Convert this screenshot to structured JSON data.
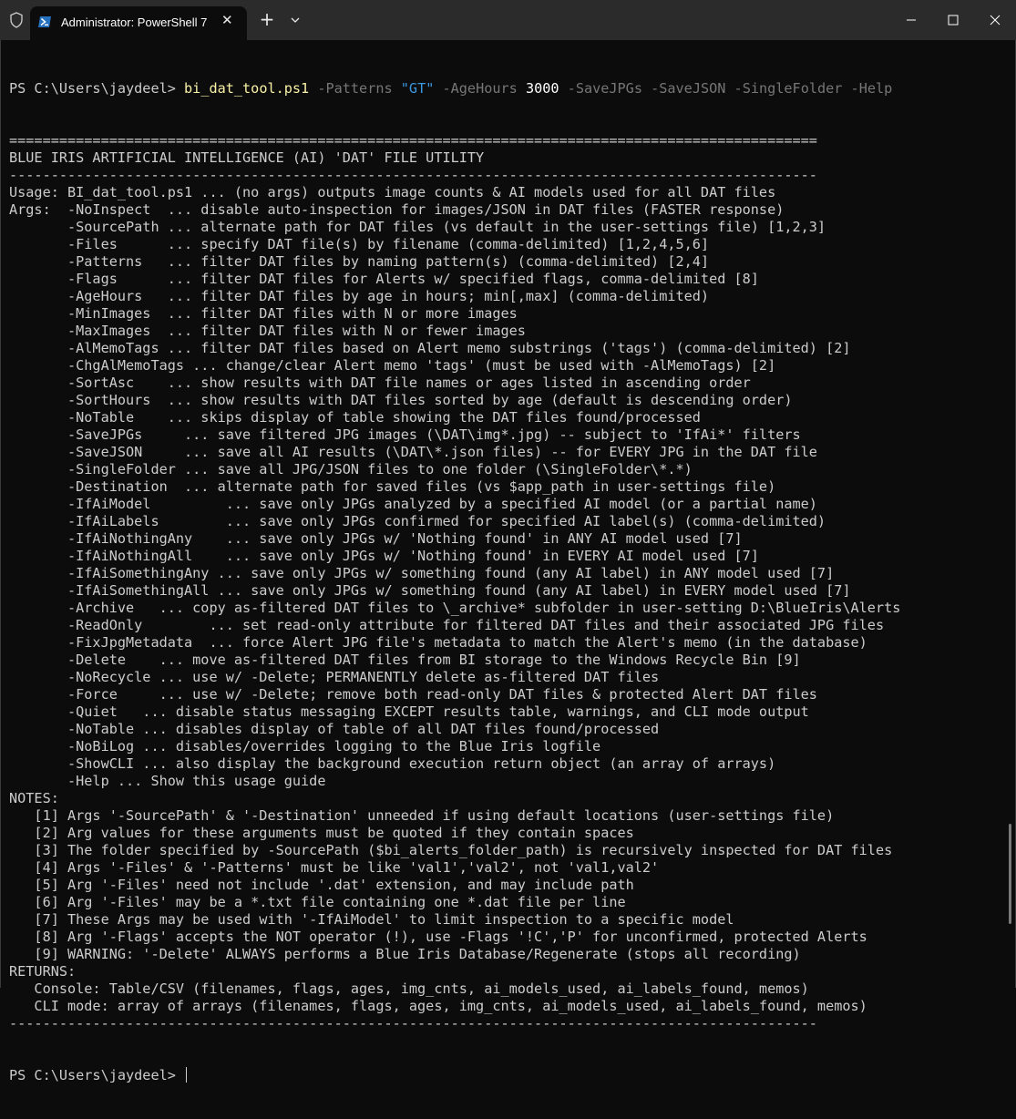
{
  "window": {
    "tab_title": "Administrator: PowerShell 7",
    "new_tab_symbol": "+",
    "tab_close_symbol": "✕",
    "icons": [
      "shield-icon",
      "powershell-icon",
      "close-icon",
      "plus-icon",
      "chevron-down-icon",
      "minimize-icon",
      "maximize-icon",
      "close-window-icon"
    ]
  },
  "colors": {
    "background": "#0c0c0c",
    "foreground": "#cccccc",
    "command": "#f9f1a5",
    "parameter": "#767676",
    "string": "#3a96dd",
    "number": "#ffffff",
    "titlebar": "#2b2b2b"
  },
  "command": {
    "prompt": "PS C:\\Users\\jaydeel> ",
    "script": "bi_dat_tool.ps1",
    "p_patterns": " -Patterns ",
    "v_patterns": "\"GT\"",
    "p_agehours": " -AgeHours ",
    "v_agehours": "3000",
    "p_rest": " -SaveJPGs -SaveJSON -SingleFolder -Help"
  },
  "output": [
    "=================================================================================================",
    "BLUE IRIS ARTIFICIAL INTELLIGENCE (AI) 'DAT' FILE UTILITY",
    "-------------------------------------------------------------------------------------------------",
    "Usage: BI_dat_tool.ps1 ... (no args) outputs image counts & AI models used for all DAT files",
    "Args:  -NoInspect  ... disable auto-inspection for images/JSON in DAT files (FASTER response)",
    "       -SourcePath ... alternate path for DAT files (vs default in the user-settings file) [1,2,3]",
    "       -Files      ... specify DAT file(s) by filename (comma-delimited) [1,2,4,5,6]",
    "       -Patterns   ... filter DAT files by naming pattern(s) (comma-delimited) [2,4]",
    "       -Flags      ... filter DAT files for Alerts w/ specified flags, comma-delimited [8]",
    "       -AgeHours   ... filter DAT files by age in hours; min[,max] (comma-delimited)",
    "       -MinImages  ... filter DAT files with N or more images",
    "       -MaxImages  ... filter DAT files with N or fewer images",
    "       -AlMemoTags ... filter DAT files based on Alert memo substrings ('tags') (comma-delimited) [2]",
    "       -ChgAlMemoTags ... change/clear Alert memo 'tags' (must be used with -AlMemoTags) [2]",
    "       -SortAsc    ... show results with DAT file names or ages listed in ascending order",
    "       -SortHours  ... show results with DAT files sorted by age (default is descending order)",
    "       -NoTable    ... skips display of table showing the DAT files found/processed",
    "       -SaveJPGs     ... save filtered JPG images (\\DAT\\img*.jpg) -- subject to 'IfAi*' filters",
    "       -SaveJSON     ... save all AI results (\\DAT\\*.json files) -- for EVERY JPG in the DAT file",
    "       -SingleFolder ... save all JPG/JSON files to one folder (\\SingleFolder\\*.*)",
    "       -Destination  ... alternate path for saved files (vs $app_path in user-settings file)",
    "       -IfAiModel         ... save only JPGs analyzed by a specified AI model (or a partial name)",
    "       -IfAiLabels        ... save only JPGs confirmed for specified AI label(s) (comma-delimited)",
    "       -IfAiNothingAny    ... save only JPGs w/ 'Nothing found' in ANY AI model used [7]",
    "       -IfAiNothingAll    ... save only JPGs w/ 'Nothing found' in EVERY AI model used [7]",
    "       -IfAiSomethingAny ... save only JPGs w/ something found (any AI label) in ANY model used [7]",
    "       -IfAiSomethingAll ... save only JPGs w/ something found (any AI label) in EVERY model used [7]",
    "       -Archive   ... copy as-filtered DAT files to \\_archive* subfolder in user-setting D:\\BlueIris\\Alerts",
    "       -ReadOnly        ... set read-only attribute for filtered DAT files and their associated JPG files",
    "       -FixJpgMetadata  ... force Alert JPG file's metadata to match the Alert's memo (in the database)",
    "       -Delete    ... move as-filtered DAT files from BI storage to the Windows Recycle Bin [9]",
    "       -NoRecycle ... use w/ -Delete; PERMANENTLY delete as-filtered DAT files",
    "       -Force     ... use w/ -Delete; remove both read-only DAT files & protected Alert DAT files",
    "       -Quiet   ... disable status messaging EXCEPT results table, warnings, and CLI mode output",
    "       -NoTable ... disables display of table of all DAT files found/processed",
    "       -NoBiLog ... disables/overrides logging to the Blue Iris logfile",
    "       -ShowCLI ... also display the background execution return object (an array of arrays)",
    "       -Help ... Show this usage guide",
    "NOTES:",
    "   [1] Args '-SourcePath' & '-Destination' unneeded if using default locations (user-settings file)",
    "   [2] Arg values for these arguments must be quoted if they contain spaces",
    "   [3] The folder specified by -SourcePath ($bi_alerts_folder_path) is recursively inspected for DAT files",
    "   [4] Args '-Files' & '-Patterns' must be like 'val1','val2', not 'val1,val2'",
    "   [5] Arg '-Files' need not include '.dat' extension, and may include path",
    "   [6] Arg '-Files' may be a *.txt file containing one *.dat file per line",
    "   [7] These Args may be used with '-IfAiModel' to limit inspection to a specific model",
    "   [8] Arg '-Flags' accepts the NOT operator (!), use -Flags '!C','P' for unconfirmed, protected Alerts",
    "   [9] WARNING: '-Delete' ALWAYS performs a Blue Iris Database/Regenerate (stops all recording)",
    "RETURNS:",
    "   Console: Table/CSV (filenames, flags, ages, img_cnts, ai_models_used, ai_labels_found, memos)",
    "   CLI mode: array of arrays (filenames, flags, ages, img_cnts, ai_models_used, ai_labels_found, memos)",
    "-------------------------------------------------------------------------------------------------"
  ],
  "final_prompt": "PS C:\\Users\\jaydeel> "
}
